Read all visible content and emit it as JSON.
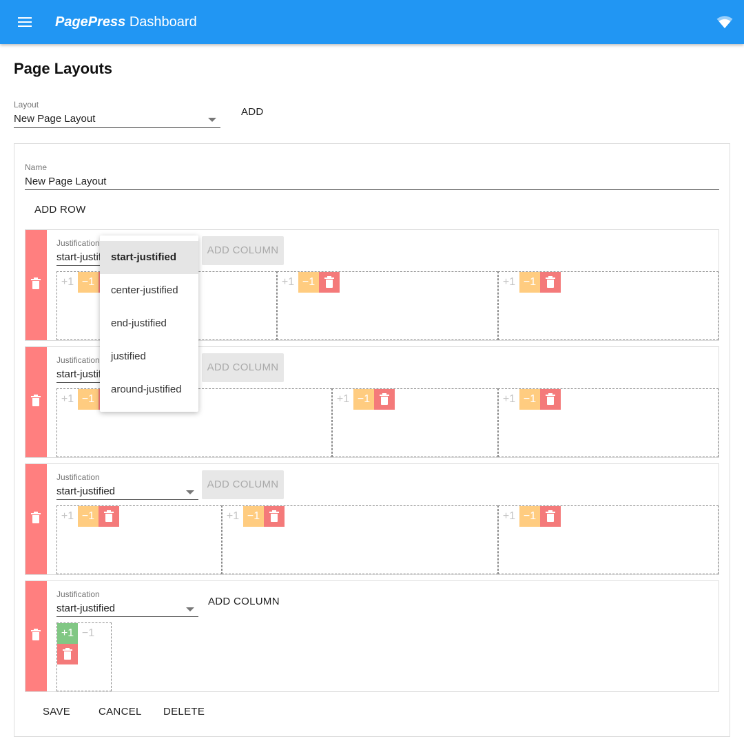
{
  "app": {
    "brand": "PagePress",
    "title_suffix": " Dashboard"
  },
  "page_title": "Page Layouts",
  "layout_select": {
    "label": "Layout",
    "value": "New Page Layout"
  },
  "add_label": "ADD",
  "name_field": {
    "label": "Name",
    "value": "New Page Layout"
  },
  "add_row_label": "ADD ROW",
  "rows": [
    {
      "justification_label": "Justification",
      "justification_value": "start-justified",
      "add_column_label": "ADD COLUMN",
      "add_column_enabled": false
    },
    {
      "justification_label": "Justification",
      "justification_value": "start-justified",
      "add_column_label": "ADD COLUMN",
      "add_column_enabled": false
    },
    {
      "justification_label": "Justification",
      "justification_value": "start-justified",
      "add_column_label": "ADD COLUMN",
      "add_column_enabled": false
    },
    {
      "justification_label": "Justification",
      "justification_value": "start-justified",
      "add_column_label": "ADD COLUMN",
      "add_column_enabled": true
    }
  ],
  "column_buttons": {
    "plus": "+1",
    "minus": "−1"
  },
  "justification_menu": {
    "open": true,
    "selected": "start-justified",
    "options": [
      "start-justified",
      "center-justified",
      "end-justified",
      "justified",
      "around-justified"
    ]
  },
  "actions": {
    "save": "SAVE",
    "cancel": "CANCEL",
    "delete": "DELETE"
  },
  "colors": {
    "appbar": "#2196f3",
    "row_delete": "#ff7f7f",
    "plus": "#81c784",
    "minus": "#ffcc80",
    "delete": "#f47a7a"
  },
  "icons": [
    "menu-icon",
    "wifi-icon",
    "trash-icon"
  ]
}
